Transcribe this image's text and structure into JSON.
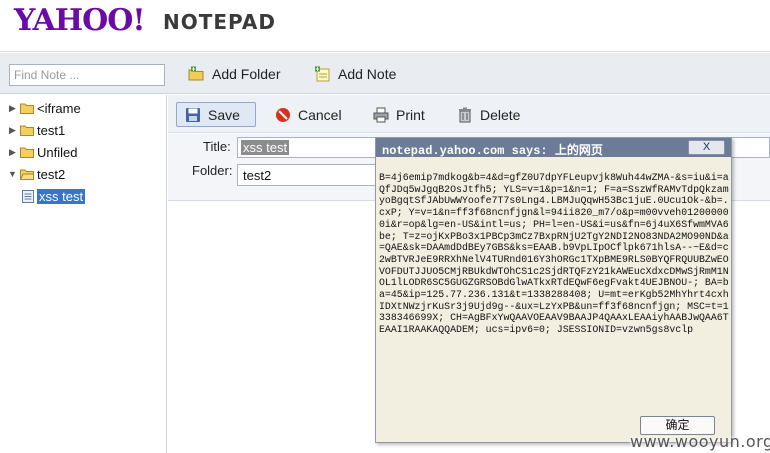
{
  "header": {
    "logo": "YAHOO!",
    "app_name": "NOTEPAD"
  },
  "toolbar": {
    "find_placeholder": "Find Note ...",
    "add_folder": "Add Folder",
    "add_note": "Add Note"
  },
  "sidebar": {
    "items": [
      {
        "label": "<iframe",
        "type": "folder",
        "expanded": false
      },
      {
        "label": "test1",
        "type": "folder",
        "expanded": false
      },
      {
        "label": "Unfiled",
        "type": "folder",
        "expanded": false
      },
      {
        "label": "test2",
        "type": "folder",
        "expanded": true
      },
      {
        "label": "xss test",
        "type": "note",
        "selected": true
      }
    ]
  },
  "actions": {
    "save": "Save",
    "cancel": "Cancel",
    "print": "Print",
    "delete": "Delete"
  },
  "form": {
    "title_label": "Title:",
    "title_value": "xss test",
    "folder_label": "Folder:",
    "folder_value": "test2"
  },
  "dialog": {
    "title": "notepad.yahoo.com says: 上的网页",
    "close_label": "X",
    "message": "B=4j6emip7mdkog&b=4&d=gfZ0U7dpYFLeupvjk8Wuh44wZMA-&s=iu&i=aQfJDq5wJgqB2OsJtfh5; YLS=v=1&p=1&n=1; F=a=SszWfRAMvTdpQkzamyoBgqtSfJAbUwWYoofe7T7s0Lng4.LBMJuQqwH53Bc1juE.0Ucu1Ok-&b=.cxP; Y=v=1&n=ff3f68ncnfjgn&l=94ii820_m7/o&p=m00vveh012000000i&r=op&lg=en-US&intl=us; PH=l=en-US&i=us&fn=6j4uX6SfwmMVA6be; T=z=ojKxPBo3x1PBCp3mCz7BxpRNjU2TgY2NDI2NO83NDA2MO90ND&a=QAE&sk=DAAmdDdBEy7GBS&ks=EAAB.b9VpLIpOCflpk671hlsA--~E&d=c2wBTVRJeE9RRXhNelV4TURnd016Y3hORGc1TXpBME9RLS0BYQFRQUUBZwEOVOFDUTJJUO5CMjRBUkdWTOhCS1c2SjdRTQFzY21kAWEucXdxcDMwSjRmM1NOL1lLODR6SC5GUGZGRSOBdGlwATkxRTdEQwF6egFvakt4UEJBNOU-; BA=ba=45&ip=125.77.236.131&t=1338288408; U=mt=erKgb52MhYhrt4cxhIDXtNWzjrKuSr3j9Ujd9g--&ux=LzYxPB&un=ff3f68ncnfjgn; MSC=t=1338346699X; CH=AgBFxYwQAAVOEAAV9BAAJP4QAAxLEAAiyhAABJwQAA6TEAAI1RAAKAQQADEM; ucs=ipv6=0; JSESSIONID=vzwn5gs8vclp",
    "ok_label": "确定"
  },
  "watermark": "www.wooyun.org",
  "colors": {
    "brand_purple": "#6b0aa6",
    "selection_blue": "#3874c8",
    "dialog_titlebar": "#6c7c97",
    "dialog_bg": "#f2efe1"
  }
}
